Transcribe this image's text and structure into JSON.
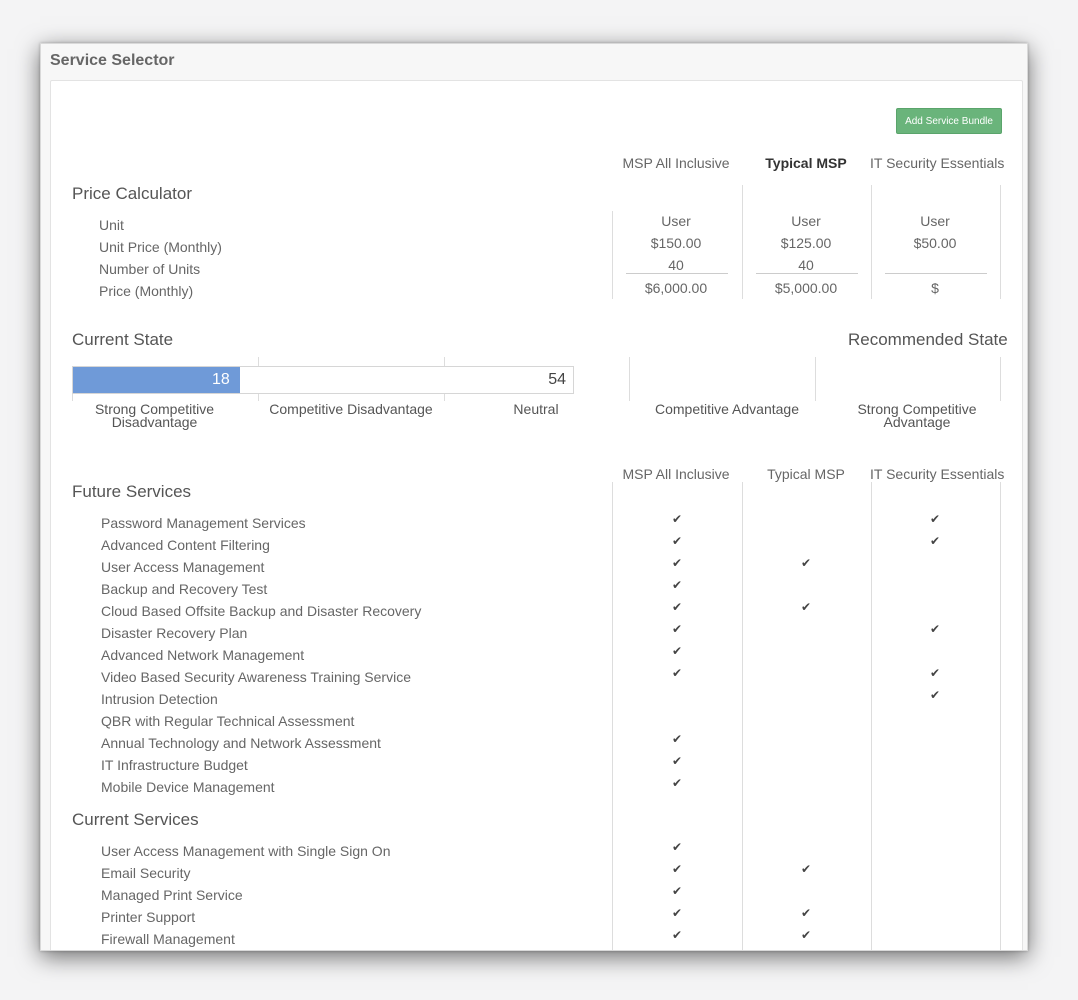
{
  "window": {
    "title": "Service Selector"
  },
  "toolbar": {
    "add_bundle_label": "Add Service Bundle"
  },
  "bundles": [
    {
      "name": "MSP All Inclusive",
      "bold": false
    },
    {
      "name": "Typical MSP",
      "bold": true
    },
    {
      "name": "IT Security Essentials",
      "bold": false
    }
  ],
  "bundles_lower": [
    "MSP All Inclusive",
    "Typical MSP",
    "IT Security Essentials"
  ],
  "price_calculator": {
    "title": "Price Calculator",
    "rows": [
      "Unit",
      "Unit Price (Monthly)",
      "Number of Units",
      "Price (Monthly)"
    ],
    "columns": [
      {
        "unit": "User",
        "unit_price": "$150.00",
        "units": "40",
        "price": "$6,000.00"
      },
      {
        "unit": "User",
        "unit_price": "$125.00",
        "units": "40",
        "price": "$5,000.00"
      },
      {
        "unit": "User",
        "unit_price": "$50.00",
        "units": "",
        "price": "$"
      }
    ]
  },
  "state": {
    "current_title": "Current State",
    "recommended_title": "Recommended State",
    "bar_fill_value": "18",
    "bar_fill_fraction": 0.333,
    "bar_end_value": "54",
    "labels": [
      "Strong Competitive Disadvantage",
      "Competitive Disadvantage",
      "Neutral",
      "Competitive Advantage",
      "Strong Competitive Advantage"
    ]
  },
  "future_services": {
    "title": "Future Services",
    "items": [
      {
        "name": "Password Management Services",
        "checks": [
          true,
          false,
          true
        ]
      },
      {
        "name": "Advanced Content Filtering",
        "checks": [
          true,
          false,
          true
        ]
      },
      {
        "name": "User Access Management",
        "checks": [
          true,
          true,
          false
        ]
      },
      {
        "name": "Backup and Recovery Test",
        "checks": [
          true,
          false,
          false
        ]
      },
      {
        "name": "Cloud Based Offsite Backup and Disaster Recovery",
        "checks": [
          true,
          true,
          false
        ]
      },
      {
        "name": "Disaster Recovery Plan",
        "checks": [
          true,
          false,
          true
        ]
      },
      {
        "name": "Advanced Network Management",
        "checks": [
          true,
          false,
          false
        ]
      },
      {
        "name": "Video Based Security Awareness Training Service",
        "checks": [
          true,
          false,
          true
        ]
      },
      {
        "name": "Intrusion Detection",
        "checks": [
          false,
          false,
          true
        ]
      },
      {
        "name": "QBR with Regular Technical Assessment",
        "checks": [
          false,
          false,
          false
        ]
      },
      {
        "name": "Annual Technology and Network Assessment",
        "checks": [
          true,
          false,
          false
        ]
      },
      {
        "name": "IT Infrastructure Budget",
        "checks": [
          true,
          false,
          false
        ]
      },
      {
        "name": "Mobile Device Management",
        "checks": [
          true,
          false,
          false
        ]
      }
    ]
  },
  "current_services": {
    "title": "Current Services",
    "items": [
      {
        "name": "User Access Management with Single Sign On",
        "checks": [
          true,
          false,
          false
        ]
      },
      {
        "name": "Email Security",
        "checks": [
          true,
          true,
          false
        ]
      },
      {
        "name": "Managed Print Service",
        "checks": [
          true,
          false,
          false
        ]
      },
      {
        "name": "Printer Support",
        "checks": [
          true,
          true,
          false
        ]
      },
      {
        "name": "Firewall Management",
        "checks": [
          true,
          true,
          false
        ]
      }
    ]
  },
  "check_glyph": "✔"
}
